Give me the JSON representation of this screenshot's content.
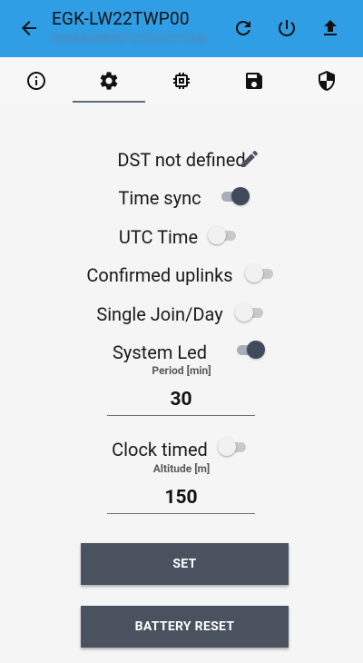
{
  "header": {
    "title": "EGK-LW22TWP00",
    "subtitle": "0004A30B001C0530 [1234]",
    "back_icon": "arrow-back-icon",
    "actions": [
      "refresh-icon",
      "power-icon",
      "upload-icon"
    ],
    "background": "#2f9ee5"
  },
  "tabs": [
    {
      "icon": "info-icon",
      "selected": false
    },
    {
      "icon": "gear-icon",
      "selected": true
    },
    {
      "icon": "chip-icon",
      "selected": false
    },
    {
      "icon": "save-icon",
      "selected": false
    },
    {
      "icon": "shield-icon",
      "selected": false
    }
  ],
  "settings": {
    "dst_label": "DST not defined",
    "time_sync": {
      "label": "Time sync",
      "on": true
    },
    "utc_time": {
      "label": "UTC Time",
      "on": false
    },
    "confirmed_uplinks": {
      "label": "Confirmed uplinks",
      "on": false
    },
    "single_join": {
      "label": "Single Join/Day",
      "on": false
    },
    "system_led": {
      "label": "System Led",
      "on": true
    },
    "period": {
      "label": "Period [min]",
      "value": "30"
    },
    "clock_timed": {
      "label": "Clock timed",
      "on": false
    },
    "altitude": {
      "label": "Altitude [m]",
      "value": "150"
    }
  },
  "buttons": {
    "set_label": "SET",
    "battery_reset_label": "BATTERY RESET"
  },
  "colors": {
    "accent": "#2f9ee5",
    "button": "#4a5260",
    "switch_on": "#3f4a5a"
  }
}
